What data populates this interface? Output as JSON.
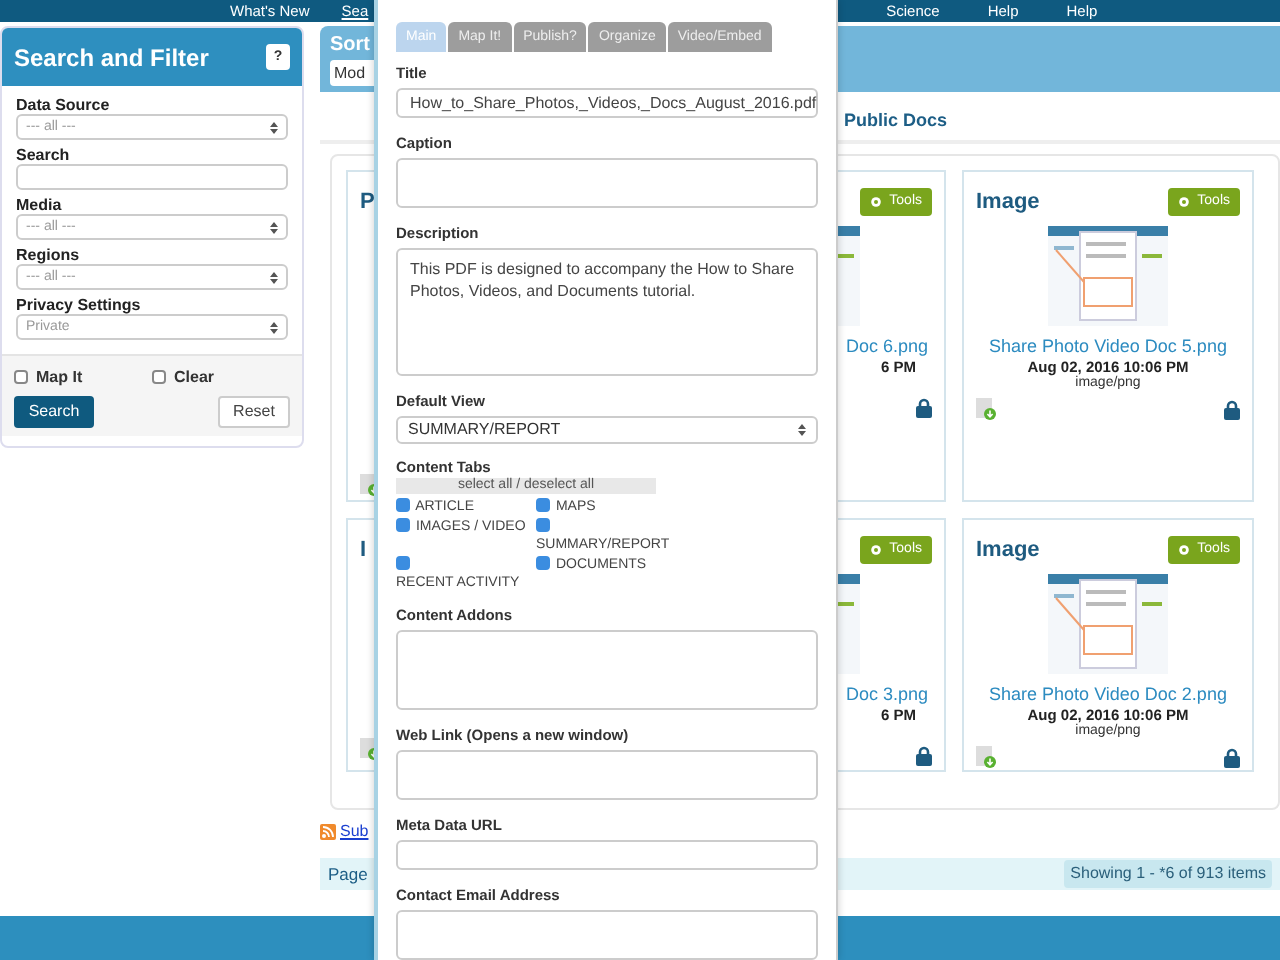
{
  "nav": {
    "left": [
      {
        "label": "What's New",
        "selected": false
      },
      {
        "label": "Sea",
        "selected": true
      }
    ],
    "right": [
      {
        "label": "Science",
        "selected": false
      },
      {
        "label": "Help",
        "selected": false
      },
      {
        "label": "Help",
        "selected": false
      }
    ]
  },
  "sidebar": {
    "title": "Search and Filter",
    "help": "?",
    "fields": [
      {
        "label": "Data Source",
        "kind": "select",
        "value": "--- all ---"
      },
      {
        "label": "Search",
        "kind": "input"
      },
      {
        "label": "Media",
        "kind": "select",
        "value": "--- all ---"
      },
      {
        "label": "Regions",
        "kind": "select",
        "value": "--- all ---"
      },
      {
        "label": "Privacy Settings",
        "kind": "select",
        "value": "Private"
      }
    ],
    "checks": [
      {
        "label": "Map It",
        "checked": false
      },
      {
        "label": "Clear",
        "checked": false
      }
    ],
    "search_button": "Search",
    "reset_button": "Reset"
  },
  "sort": {
    "label": "Sort",
    "value": "Mod"
  },
  "tab": "Public Docs",
  "cards": [
    {
      "kind": "clipped",
      "title": "P"
    },
    {
      "kind": "clipped",
      "tools": "Tools",
      "file": "Doc 6.png",
      "date": "6 PM",
      "locked": true
    },
    {
      "kind": "full",
      "title": "Image",
      "tools": "Tools",
      "file": "Share Photo Video Doc 5.png",
      "date": "Aug 02, 2016 10:06 PM",
      "mime": "image/png",
      "locked": true
    },
    {
      "kind": "clipped",
      "title": "I"
    },
    {
      "kind": "clipped",
      "tools": "Tools",
      "file": "Doc 3.png",
      "date": "6 PM",
      "locked": true
    },
    {
      "kind": "full",
      "title": "Image",
      "tools": "Tools",
      "file": "Share Photo Video Doc 2.png",
      "date": "Aug 02, 2016 10:06 PM",
      "mime": "image/png",
      "locked": true
    }
  ],
  "subscribe": "Sub",
  "pager": {
    "label": "Page",
    "showing": "Showing 1 - *6 of 913 items"
  },
  "modal": {
    "tabs": [
      {
        "label": "Main",
        "selected": true
      },
      {
        "label": "Map It!",
        "selected": false
      },
      {
        "label": "Publish?",
        "selected": false
      },
      {
        "label": "Organize",
        "selected": false
      },
      {
        "label": "Video/Embed",
        "selected": false
      }
    ],
    "fields": [
      {
        "label": "Title",
        "kind": "input",
        "value": "How_to_Share_Photos,_Videos,_Docs_August_2016.pdf"
      },
      {
        "label": "Caption",
        "kind": "textarea"
      },
      {
        "label": "Description",
        "kind": "textarea-tall",
        "value": "This PDF is designed to accompany the How to Share Photos, Videos, and Documents tutorial."
      },
      {
        "label": "Default View",
        "kind": "select",
        "value": "SUMMARY/REPORT"
      },
      {
        "label": "Content Tabs",
        "kind": "checkgroup",
        "select_all": "select all / deselect all",
        "options": [
          {
            "label": "ARTICLE",
            "checked": true
          },
          {
            "label": "MAPS",
            "checked": true
          },
          {
            "label": "IMAGES / VIDEO",
            "checked": true
          },
          {
            "label": "SUMMARY/REPORT",
            "checked": true
          },
          {
            "label": "RECENT ACTIVITY",
            "checked": true
          },
          {
            "label": "DOCUMENTS",
            "checked": true
          }
        ]
      },
      {
        "label": "Content Addons",
        "kind": "textarea-medium"
      },
      {
        "label": "Web Link (Opens a new window)",
        "kind": "textarea"
      },
      {
        "label": "Meta Data URL",
        "kind": "input"
      },
      {
        "label": "Contact Email Address",
        "kind": "textarea"
      }
    ]
  }
}
